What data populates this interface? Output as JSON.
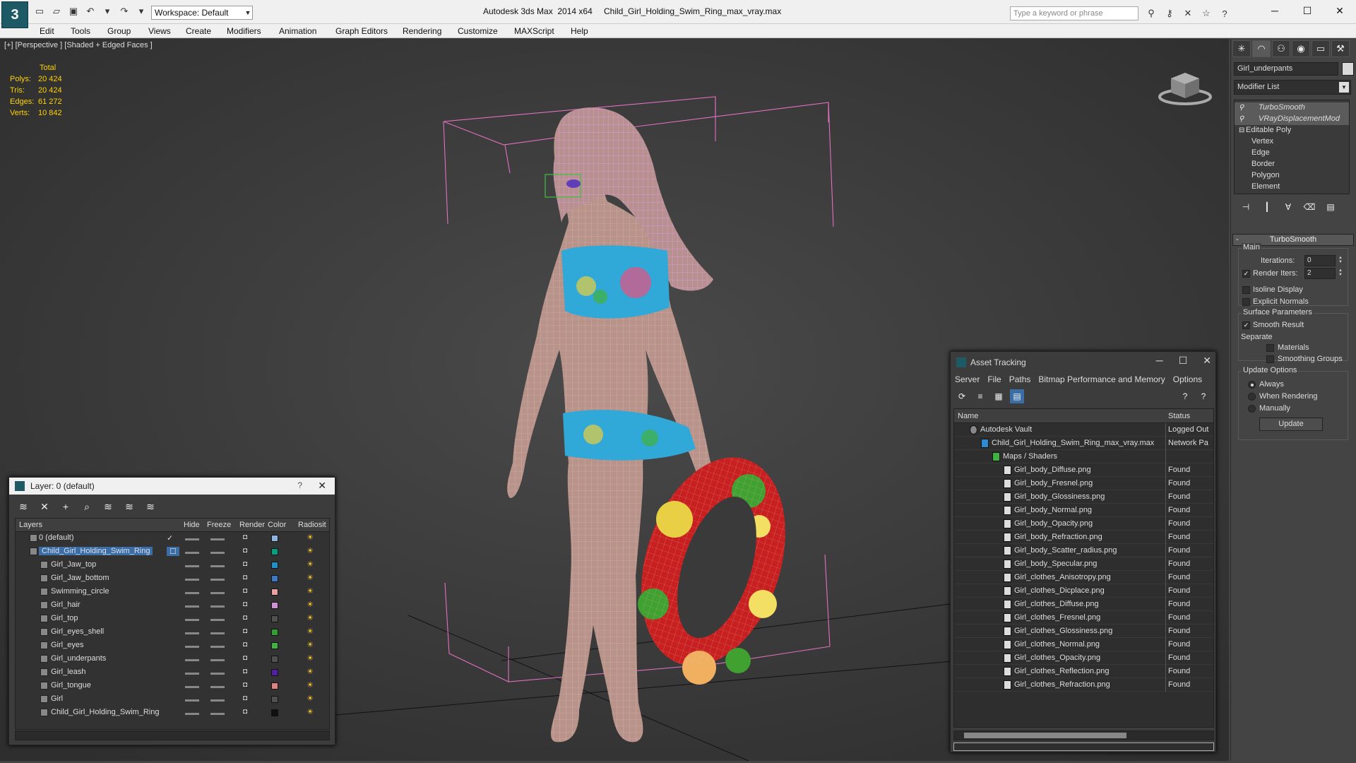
{
  "titlebar": {
    "app_title": "Autodesk 3ds Max  2014 x64",
    "file_name": "Child_Girl_Holding_Swim_Ring_max_vray.max",
    "workspace": "Workspace: Default",
    "search_placeholder": "Type a keyword or phrase"
  },
  "menu": [
    "Edit",
    "Tools",
    "Group",
    "Views",
    "Create",
    "Modifiers",
    "Animation",
    "Graph Editors",
    "Rendering",
    "Customize",
    "MAXScript",
    "Help"
  ],
  "viewport": {
    "label": "[+] [Perspective ] [Shaded + Edged Faces ]",
    "stats": {
      "total_label": "Total",
      "rows": [
        {
          "k": "Polys:",
          "v": "20 424"
        },
        {
          "k": "Tris:",
          "v": "20 424"
        },
        {
          "k": "Edges:",
          "v": "61 272"
        },
        {
          "k": "Verts:",
          "v": "10 842"
        }
      ]
    }
  },
  "command_panel": {
    "object_name": "Girl_underpants",
    "modifier_list": "Modifier List",
    "stack": [
      {
        "label": "TurboSmooth",
        "indent": 1,
        "hl": true,
        "bulb": true
      },
      {
        "label": "VRayDisplacementMod",
        "indent": 1,
        "hl": true,
        "bulb": true
      },
      {
        "label": "Editable Poly",
        "indent": 0,
        "hl": false,
        "bulb": false
      },
      {
        "label": "Vertex",
        "indent": 2,
        "hl": false,
        "bulb": false
      },
      {
        "label": "Edge",
        "indent": 2,
        "hl": false,
        "bulb": false
      },
      {
        "label": "Border",
        "indent": 2,
        "hl": false,
        "bulb": false
      },
      {
        "label": "Polygon",
        "indent": 2,
        "hl": false,
        "bulb": false
      },
      {
        "label": "Element",
        "indent": 2,
        "hl": false,
        "bulb": false
      }
    ],
    "rollout_title": "TurboSmooth",
    "main_label": "Main",
    "iterations_label": "Iterations:",
    "iterations_value": "0",
    "render_iters_label": "Render Iters:",
    "render_iters_value": "2",
    "isoline_label": "Isoline Display",
    "explicit_normals_label": "Explicit Normals",
    "surface_params_label": "Surface Parameters",
    "smooth_result_label": "Smooth Result",
    "separate_label": "Separate",
    "materials_label": "Materials",
    "smoothing_groups_label": "Smoothing Groups",
    "update_options_label": "Update Options",
    "always_label": "Always",
    "when_rendering_label": "When Rendering",
    "manually_label": "Manually",
    "update_button": "Update"
  },
  "layer_window": {
    "title": "Layer: 0 (default)",
    "help": "?",
    "columns": {
      "layers": "Layers",
      "hide": "Hide",
      "freeze": "Freeze",
      "render": "Render",
      "color": "Color",
      "radiosity": "Radiosit"
    },
    "rows": [
      {
        "name": "0 (default)",
        "indent": 0,
        "color": "#8fb3e0",
        "check": "✓",
        "sel": false
      },
      {
        "name": "Child_Girl_Holding_Swim_Ring",
        "indent": 0,
        "color": "#00a080",
        "check": "☐",
        "sel": true
      },
      {
        "name": "Girl_Jaw_top",
        "indent": 1,
        "color": "#1e90c8",
        "check": "",
        "sel": false
      },
      {
        "name": "Girl_Jaw_bottom",
        "indent": 1,
        "color": "#3c78c8",
        "check": "",
        "sel": false
      },
      {
        "name": "Swimming_circle",
        "indent": 1,
        "color": "#e8a0a0",
        "check": "",
        "sel": false
      },
      {
        "name": "Girl_hair",
        "indent": 1,
        "color": "#d090d8",
        "check": "",
        "sel": false
      },
      {
        "name": "Girl_top",
        "indent": 1,
        "color": "#505050",
        "check": "",
        "sel": false
      },
      {
        "name": "Girl_eyes_shell",
        "indent": 1,
        "color": "#30a030",
        "check": "",
        "sel": false
      },
      {
        "name": "Girl_eyes",
        "indent": 1,
        "color": "#40b040",
        "check": "",
        "sel": false
      },
      {
        "name": "Girl_underpants",
        "indent": 1,
        "color": "#505050",
        "check": "",
        "sel": false
      },
      {
        "name": "Girl_leash",
        "indent": 1,
        "color": "#5020a0",
        "check": "",
        "sel": false
      },
      {
        "name": "Girl_tongue",
        "indent": 1,
        "color": "#e08080",
        "check": "",
        "sel": false
      },
      {
        "name": "Girl",
        "indent": 1,
        "color": "#505050",
        "check": "",
        "sel": false
      },
      {
        "name": "Child_Girl_Holding_Swim_Ring",
        "indent": 1,
        "color": "#101010",
        "check": "",
        "sel": false
      }
    ]
  },
  "asset_tracking": {
    "title": "Asset Tracking",
    "menu": [
      "Server",
      "File",
      "Paths",
      "Bitmap Performance and Memory",
      "Options"
    ],
    "col_name": "Name",
    "col_status": "Status",
    "rows": [
      {
        "name": "Autodesk Vault",
        "indent": 1,
        "status": "Logged Out",
        "icon": "vault"
      },
      {
        "name": "Child_Girl_Holding_Swim_Ring_max_vray.max",
        "indent": 2,
        "status": "Network Pa",
        "icon": "max"
      },
      {
        "name": "Maps / Shaders",
        "indent": 3,
        "status": "",
        "icon": "maps"
      },
      {
        "name": "Girl_body_Diffuse.png",
        "indent": 4,
        "status": "Found",
        "icon": "file"
      },
      {
        "name": "Girl_body_Fresnel.png",
        "indent": 4,
        "status": "Found",
        "icon": "file"
      },
      {
        "name": "Girl_body_Glossiness.png",
        "indent": 4,
        "status": "Found",
        "icon": "file"
      },
      {
        "name": "Girl_body_Normal.png",
        "indent": 4,
        "status": "Found",
        "icon": "file"
      },
      {
        "name": "Girl_body_Opacity.png",
        "indent": 4,
        "status": "Found",
        "icon": "file"
      },
      {
        "name": "Girl_body_Refraction.png",
        "indent": 4,
        "status": "Found",
        "icon": "file"
      },
      {
        "name": "Girl_body_Scatter_radius.png",
        "indent": 4,
        "status": "Found",
        "icon": "file"
      },
      {
        "name": "Girl_body_Specular.png",
        "indent": 4,
        "status": "Found",
        "icon": "file"
      },
      {
        "name": "Girl_clothes_Anisotropy.png",
        "indent": 4,
        "status": "Found",
        "icon": "file"
      },
      {
        "name": "Girl_clothes_Dicplace.png",
        "indent": 4,
        "status": "Found",
        "icon": "file"
      },
      {
        "name": "Girl_clothes_Diffuse.png",
        "indent": 4,
        "status": "Found",
        "icon": "file"
      },
      {
        "name": "Girl_clothes_Fresnel.png",
        "indent": 4,
        "status": "Found",
        "icon": "file"
      },
      {
        "name": "Girl_clothes_Glossiness.png",
        "indent": 4,
        "status": "Found",
        "icon": "file"
      },
      {
        "name": "Girl_clothes_Normal.png",
        "indent": 4,
        "status": "Found",
        "icon": "file"
      },
      {
        "name": "Girl_clothes_Opacity.png",
        "indent": 4,
        "status": "Found",
        "icon": "file"
      },
      {
        "name": "Girl_clothes_Reflection.png",
        "indent": 4,
        "status": "Found",
        "icon": "file"
      },
      {
        "name": "Girl_clothes_Refraction.png",
        "indent": 4,
        "status": "Found",
        "icon": "file"
      }
    ]
  }
}
